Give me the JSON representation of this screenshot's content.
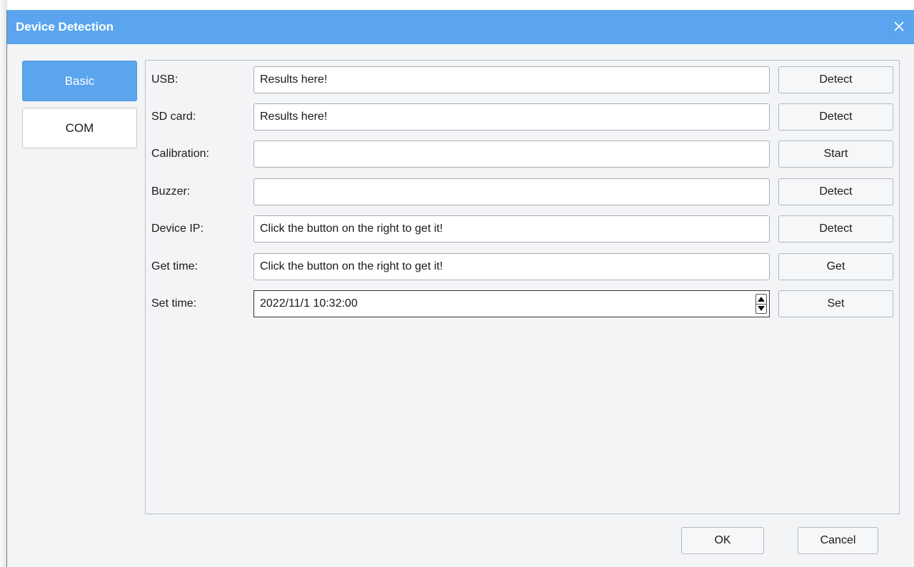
{
  "window": {
    "title": "Device Detection",
    "accent": "#5aa5ee"
  },
  "nav": {
    "items": [
      {
        "label": "Basic",
        "active": true
      },
      {
        "label": "COM",
        "active": false
      }
    ]
  },
  "rows": [
    {
      "label": "USB:",
      "value": "Results here!",
      "button": "Detect"
    },
    {
      "label": "SD card:",
      "value": "Results here!",
      "button": "Detect"
    },
    {
      "label": "Calibration:",
      "value": "",
      "button": "Start"
    },
    {
      "label": "Buzzer:",
      "value": "",
      "button": "Detect"
    },
    {
      "label": "Device IP:",
      "value": "Click the button on the right to get it!",
      "button": "Detect"
    },
    {
      "label": "Get time:",
      "value": "Click the button on the right to get it!",
      "button": "Get"
    },
    {
      "label": "Set time:",
      "value": "2022/11/1 10:32:00",
      "button": "Set"
    }
  ],
  "footer": {
    "ok": "OK",
    "cancel": "Cancel"
  },
  "icons": {
    "close": "close-icon",
    "spin_up": "spin-up-icon",
    "spin_down": "spin-down-icon"
  }
}
